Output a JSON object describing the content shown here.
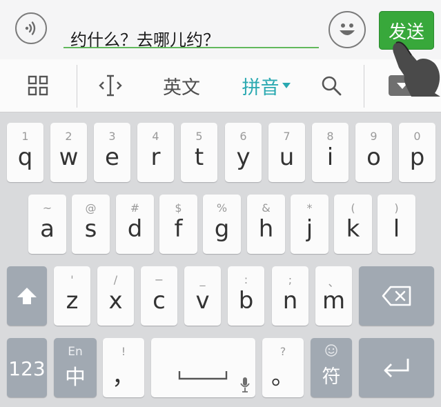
{
  "chat": {
    "message": "约什么？去哪儿约？",
    "send_label": "发送"
  },
  "toolbar": {
    "english_label": "英文",
    "pinyin_label": "拼音"
  },
  "keyboard": {
    "row1": [
      {
        "hint": "1",
        "key": "q"
      },
      {
        "hint": "2",
        "key": "w"
      },
      {
        "hint": "3",
        "key": "e"
      },
      {
        "hint": "4",
        "key": "r"
      },
      {
        "hint": "5",
        "key": "t"
      },
      {
        "hint": "6",
        "key": "y"
      },
      {
        "hint": "7",
        "key": "u"
      },
      {
        "hint": "8",
        "key": "i"
      },
      {
        "hint": "9",
        "key": "o"
      },
      {
        "hint": "0",
        "key": "p"
      }
    ],
    "row2": [
      {
        "hint": "~",
        "key": "a"
      },
      {
        "hint": "@",
        "key": "s"
      },
      {
        "hint": "#",
        "key": "d"
      },
      {
        "hint": "$",
        "key": "f"
      },
      {
        "hint": "%",
        "key": "g"
      },
      {
        "hint": "&",
        "key": "h"
      },
      {
        "hint": "*",
        "key": "j"
      },
      {
        "hint": "(",
        "key": "k"
      },
      {
        "hint": ")",
        "key": "l"
      }
    ],
    "row3": [
      {
        "hint": "'",
        "key": "z"
      },
      {
        "hint": "/",
        "key": "x"
      },
      {
        "hint": "−",
        "key": "c"
      },
      {
        "hint": "_",
        "key": "v"
      },
      {
        "hint": ":",
        "key": "b"
      },
      {
        "hint": ";",
        "key": "n"
      },
      {
        "hint": "、",
        "key": "m"
      }
    ],
    "num_label": "123",
    "lang_hint": "En",
    "lang_label": "中",
    "comma_hint": "!",
    "comma_label": "，",
    "period_hint": "?",
    "period_label": "。",
    "symbol_label": "符"
  }
}
